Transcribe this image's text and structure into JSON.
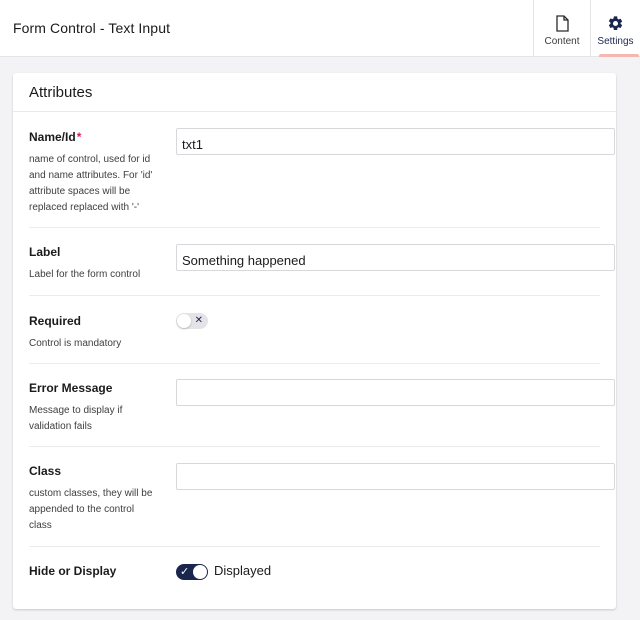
{
  "header": {
    "title": "Form Control - Text Input",
    "apps": [
      {
        "label": "Content",
        "icon": "document-icon"
      },
      {
        "label": "Settings",
        "icon": "gear-icon",
        "active": true
      }
    ]
  },
  "panel": {
    "title": "Attributes",
    "properties": [
      {
        "label": "Name/Id",
        "required_mark": "*",
        "description": "name of control, used for id and name attributes. For 'id' attribute spaces will be replaced replaced with '-'",
        "value": "txt1"
      },
      {
        "label": "Label",
        "description": "Label for the form control",
        "value": "Something happened"
      },
      {
        "label": "Required",
        "description": "Control is mandatory",
        "toggle_state": "off",
        "toggle_mark": "✕"
      },
      {
        "label": "Error Message",
        "description": "Message to display if validation fails",
        "value": ""
      },
      {
        "label": "Class",
        "description": "custom classes, they will be appended to the control class",
        "value": ""
      },
      {
        "label": "Hide or Display",
        "toggle_state": "on",
        "toggle_mark": "✓",
        "toggle_text": "Displayed"
      }
    ]
  },
  "colors": {
    "brand": "#1b264f",
    "required": "#d42054",
    "active_underline": "#f5b7b0"
  }
}
